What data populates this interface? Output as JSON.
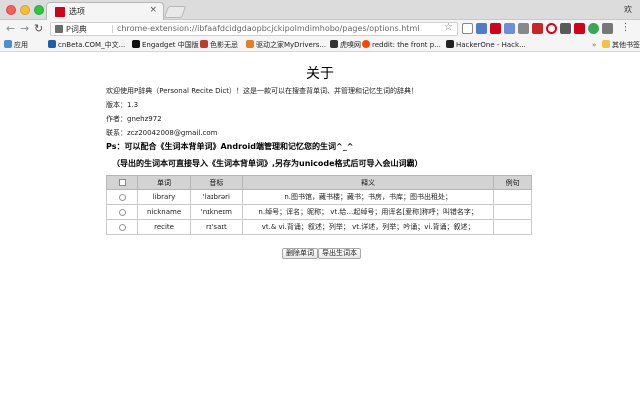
{
  "browser": {
    "tab_title": "选项",
    "tab_close": "×",
    "profile": "欢",
    "omnibox_scheme": "P词典",
    "omnibox_url": "chrome-extension://ibfaafdcidgdaopbcjckipolmdimhobo/pages/options.html",
    "nav": {
      "back": "←",
      "forward": "→",
      "reload": "↻"
    },
    "star": "☆",
    "extension_icons": [
      "star-icon",
      "grid-extension-icon",
      "red-extension-icon",
      "grid-extension-icon",
      "extension-icon",
      "red-extension-icon",
      "opera-icon",
      "extension-icon",
      "red-extension-icon",
      "refresh-extension-icon",
      "extension-icon",
      "menu-icon"
    ],
    "bookmarks": [
      {
        "label": "应用",
        "color": "#4a90d9"
      },
      {
        "label": "cnBeta.COM_中文...",
        "color": "#1a5fb4"
      },
      {
        "label": "Engadget 中国版",
        "color": "#111111"
      },
      {
        "label": "色影无忌",
        "color": "#c0392b"
      },
      {
        "label": "驱动之家MyDrivers...",
        "color": "#e67e22"
      },
      {
        "label": "虎嗅网",
        "color": "#333333"
      },
      {
        "label": "reddit: the front p...",
        "color": "#ff4500"
      },
      {
        "label": "HackerOne - Hack...",
        "color": "#222222"
      }
    ],
    "bookmarks_more": "»",
    "bookmarks_other": "其他书签"
  },
  "page": {
    "title": "关于",
    "intro": "欢迎使用P辞典（Personal Recite Dict）！这是一款可以在搜查背单词、并管理和记忆生词的辞典！",
    "version": "版本：1.3",
    "author": "作者：gnehz972",
    "contact": "联系：zcz20042008@gmail.com",
    "ps": "Ps：可以配合《生词本背单词》Android端管理和记忆您的生词^_^",
    "note": "（导出的生词本可直接导入《生词本背单词》,另存为unicode格式后可导入会山词霸）"
  },
  "table": {
    "headers": [
      "单词",
      "音标",
      "释义",
      "例句"
    ],
    "rows": [
      {
        "word": "library",
        "phonetic": "'laɪbrəri",
        "meaning": "n.图书馆，藏书楼；藏书；书房，书库；图书出租处；",
        "example": ""
      },
      {
        "word": "nickname",
        "phonetic": "'nɪkneɪm",
        "meaning": "n.绰号；诨名；昵称； vt.给…起绰号；用诨名[爱称]称呼；叫错名字；",
        "example": ""
      },
      {
        "word": "recite",
        "phonetic": "rɪ'saɪt",
        "meaning": "vt.& vi.背诵；叙述；列举； vt.详述，列举；吟诵；vi.背诵；叙述；",
        "example": ""
      }
    ]
  },
  "actions": {
    "delete_label": "删除单词",
    "export_label": "导出生词本"
  },
  "colors": {
    "favicon": "#d0021b",
    "header_bg": "#d3d3d3"
  }
}
